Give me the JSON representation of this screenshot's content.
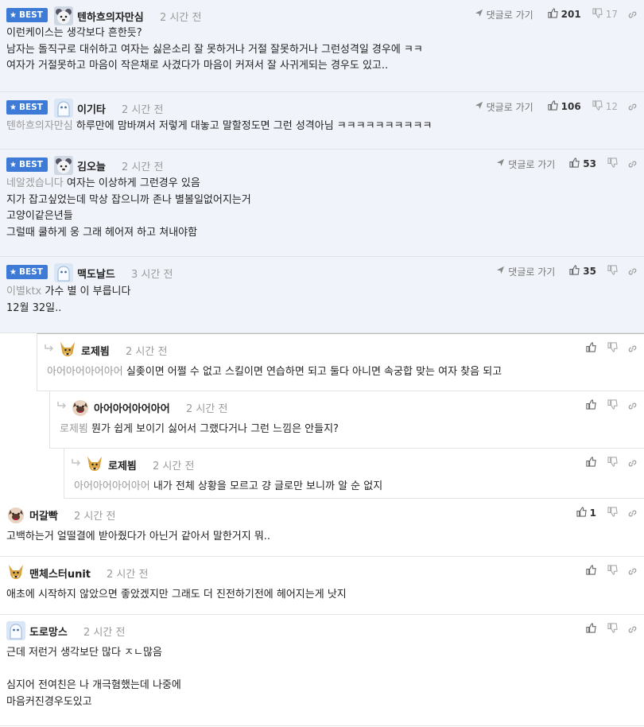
{
  "labels": {
    "best": "BEST",
    "reply": "댓글로 가기"
  },
  "colors": {
    "best_bg": "#f0f4fa",
    "badge": "#3d7bd6",
    "meta": "#9a9a9a"
  },
  "comments": [
    {
      "nick": "텐하흐의자만심",
      "time": "2 시간 전",
      "up": "201",
      "down": "17",
      "mention": "",
      "text": "이런케이스는 생각보다 흔한듯?\n남자는 돌직구로 대쉬하고 여자는 싫은소리 잘 못하거나 거절 잘못하거나 그런성격일 경우에 ㅋㅋ\n여자가 거절못하고 마음이 작은채로 사겼다가 마음이 커져서 잘 사귀게되는 경우도 있고.."
    },
    {
      "nick": "이기타",
      "time": "2 시간 전",
      "up": "106",
      "down": "12",
      "mention": "텐하흐의자만심",
      "text": "하루만에 맘바껴서 저렇게 대놓고 말할정도면 그런 성격아님 ㅋㅋㅋㅋㅋㅋㅋㅋㅋㅋ"
    },
    {
      "nick": "김오늘",
      "time": "2 시간 전",
      "up": "53",
      "down": "",
      "mention": "네알겠습니다",
      "text": "여자는 이상하게 그런경우 있음\n지가 잡고싶었는데 막상 잡으니까 존나 별볼일없어지는거\n고양이같은년들\n그럴때 쿨하게 웅 그래 헤어져 하고 쳐내야함"
    },
    {
      "nick": "맥도날드",
      "time": "3 시간 전",
      "up": "35",
      "down": "",
      "mention": "이별ktx",
      "text": "가수 별 이 부릅니다\n12월 32일.."
    },
    {
      "nick": "로제뵘",
      "time": "2 시간 전",
      "up": "",
      "down": "",
      "mention": "아어아어아어아어",
      "text": "실좆이면 어쩔 수 없고 스킬이면 연습하면 되고 둘다 아니면 속궁합 맞는 여자 찾음 되고"
    },
    {
      "nick": "아어아어아어아어",
      "time": "2 시간 전",
      "up": "",
      "down": "",
      "mention": "로제뵘",
      "text": "뭔가 쉽게 보이기 싫어서 그랬다거나 그런 느낌은 안들지?"
    },
    {
      "nick": "로제뵘",
      "time": "2 시간 전",
      "up": "",
      "down": "",
      "mention": "아어아어아어아어",
      "text": "내가 전체 상황을 모르고 걍 글로만 보니까 알 순 없지"
    },
    {
      "nick": "머갈빡",
      "time": "2 시간 전",
      "up": "1",
      "down": "",
      "mention": "",
      "text": "고백하는거 얼떨결에 받아줬다가 아닌거 같아서 말한거지 뭐.."
    },
    {
      "nick": "맨체스터unit",
      "time": "2 시간 전",
      "up": "",
      "down": "",
      "mention": "",
      "text": "애초에 시작하지 않았으면 좋았겠지만 그래도 더 진전하기전에 헤어지는게 낫지"
    },
    {
      "nick": "도로망스",
      "time": "2 시간 전",
      "up": "",
      "down": "",
      "mention": "",
      "text": "근데 저런거 생각보단 많다 ㅈㄴ많음\n\n심지어 전여친은 나 개극혐했는데 나중에\n마음커진경우도있고"
    }
  ]
}
